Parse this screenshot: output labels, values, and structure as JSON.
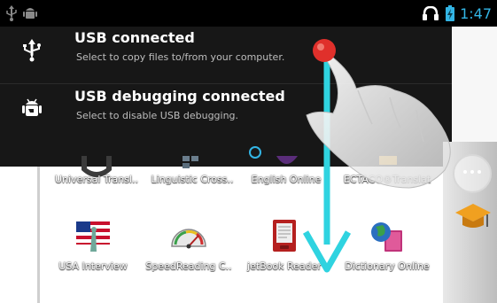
{
  "status_bar": {
    "time": "1:47",
    "left_icons": [
      "usb-icon",
      "android-debug-icon"
    ],
    "right_icons": [
      "headphones-icon",
      "battery-icon"
    ]
  },
  "notifications": [
    {
      "icon": "usb-icon",
      "title": "USB connected",
      "subtitle": "Select to copy files to/from your computer."
    },
    {
      "icon": "android-debug-icon",
      "title": "USB debugging connected",
      "subtitle": "Select to disable USB debugging."
    }
  ],
  "apps_row1": [
    {
      "label": "Universal Transl.."
    },
    {
      "label": "Linguistic Cross.."
    },
    {
      "label": "English Online"
    },
    {
      "label": "ECTACO®Translat"
    }
  ],
  "apps_row2": [
    {
      "label": "USA Interview"
    },
    {
      "label": "SpeedReading C.."
    },
    {
      "label": "jetBook Reader"
    },
    {
      "label": "Dictionary Online"
    }
  ],
  "colors": {
    "accent": "#33b5e5",
    "swipe_arrow": "#2fd3e0",
    "touch_point": "#e0302b"
  }
}
